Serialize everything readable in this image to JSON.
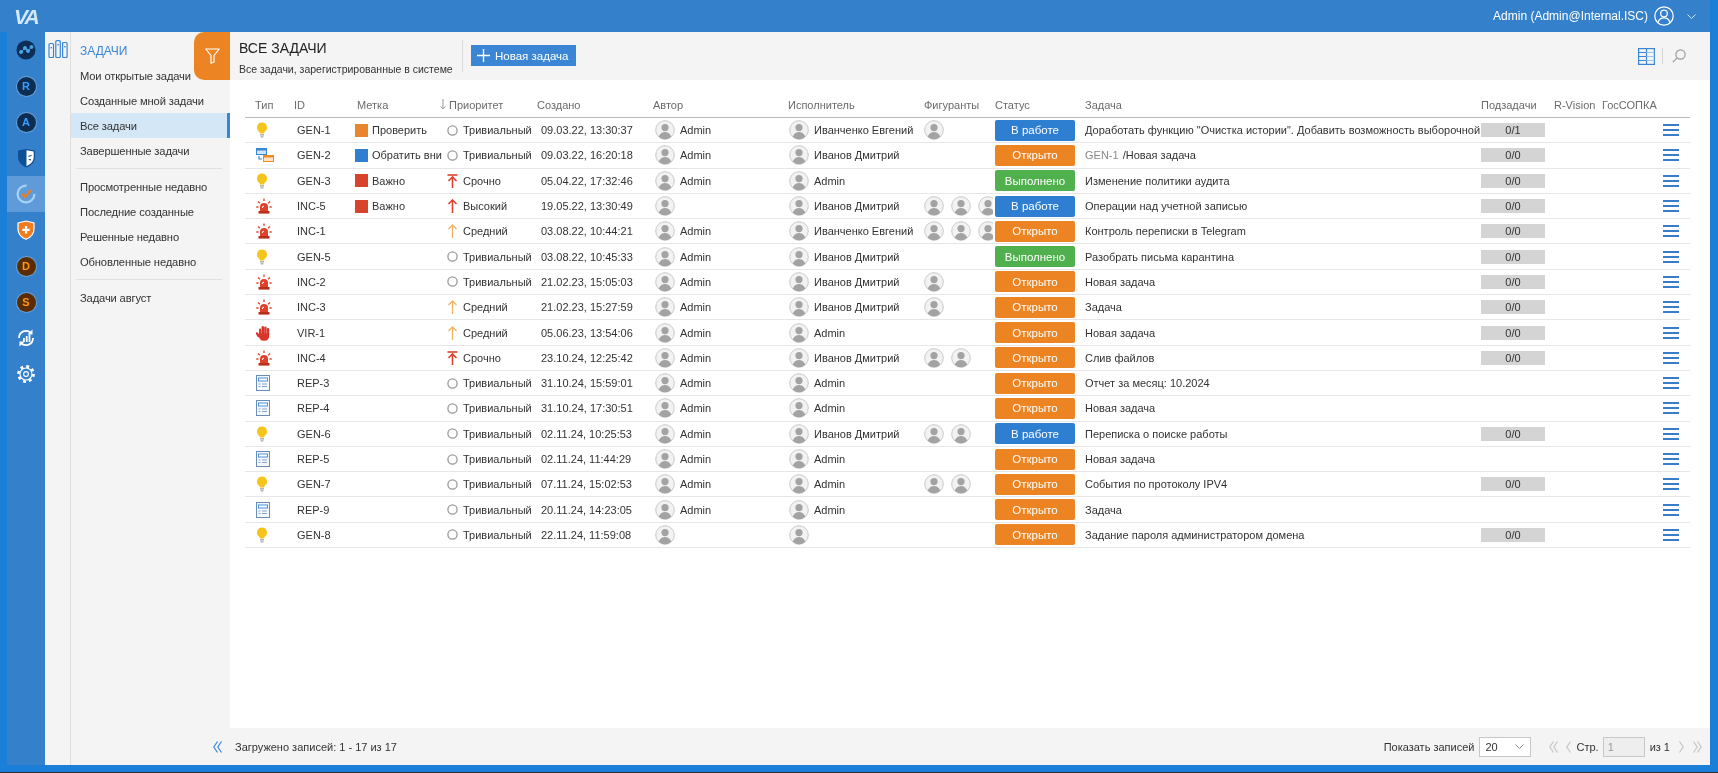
{
  "topbar": {
    "logo": "VA",
    "user": "Admin (Admin@Internal.ISC)"
  },
  "rail": [
    {
      "kind": "network",
      "selected": false
    },
    {
      "kind": "letter",
      "label": "R",
      "color": "#0c2e52",
      "selected": false
    },
    {
      "kind": "letter",
      "label": "A",
      "color": "#0c2e52",
      "selected": false
    },
    {
      "kind": "shield-mask",
      "selected": false
    },
    {
      "kind": "check-ring",
      "selected": true
    },
    {
      "kind": "shield-plus",
      "selected": false
    },
    {
      "kind": "letter",
      "label": "D",
      "color": "#5a2c00",
      "selected": false
    },
    {
      "kind": "letter",
      "label": "S",
      "color": "#5a2c00",
      "selected": false
    },
    {
      "kind": "sync-chart",
      "selected": false
    },
    {
      "kind": "gear",
      "selected": false
    }
  ],
  "nav": {
    "title": "ЗАДАЧИ",
    "groups": [
      {
        "items": [
          {
            "label": "Мои открытые задачи",
            "selected": false
          },
          {
            "label": "Созданные мной задачи",
            "selected": false
          },
          {
            "label": "Все задачи",
            "selected": true
          },
          {
            "label": "Завершенные задачи",
            "selected": false
          }
        ]
      },
      {
        "items": [
          {
            "label": "Просмотренные недавно",
            "selected": false
          },
          {
            "label": "Последние созданные",
            "selected": false
          },
          {
            "label": "Решенные недавно",
            "selected": false
          },
          {
            "label": "Обновленные недавно",
            "selected": false
          }
        ]
      },
      {
        "items": [
          {
            "label": "Задачи август",
            "selected": false
          }
        ]
      }
    ]
  },
  "page": {
    "title": "ВСЕ ЗАДАЧИ",
    "subtitle": "Все задачи, зарегистрированные в системе",
    "new_button": "Новая задача"
  },
  "table": {
    "columns": [
      {
        "label": "Тип",
        "sorted": false
      },
      {
        "label": "ID",
        "sorted": false
      },
      {
        "label": "Метка",
        "sorted": false
      },
      {
        "label": "Приоритет",
        "sorted": true
      },
      {
        "label": "Создано",
        "sorted": false
      },
      {
        "label": "Автор",
        "sorted": false
      },
      {
        "label": "Исполнитель",
        "sorted": false
      },
      {
        "label": "Фигуранты",
        "sorted": false
      },
      {
        "label": "Статус",
        "sorted": false
      },
      {
        "label": "Задача",
        "sorted": false
      },
      {
        "label": "Подзадачи",
        "sorted": false
      },
      {
        "label": "R-Vision",
        "sorted": false
      },
      {
        "label": "ГосСОПКА",
        "sorted": false
      }
    ],
    "rows": [
      {
        "type": {
          "kind": "bulb"
        },
        "id": "GEN-1",
        "tag": {
          "label": "Проверить",
          "color": "#e8852d"
        },
        "priority": {
          "label": "Тривиальный",
          "kind": "trivial"
        },
        "created": "09.03.22, 13:30:37",
        "author": "Admin",
        "assignee": "Иванченко Евгений",
        "figurants": [
          {
            "kind": "avatar"
          }
        ],
        "status": {
          "label": "В работе",
          "color": "#2e7fd2"
        },
        "task": "Доработать функцию \"Очистка истории\". Добавить возможность выборочной",
        "subtasks": "0/1"
      },
      {
        "type": {
          "kind": "windows"
        },
        "id": "GEN-2",
        "tag": {
          "label": "Обратить вни",
          "color": "#2f7ed2"
        },
        "priority": {
          "label": "Тривиальный",
          "kind": "trivial"
        },
        "created": "09.03.22, 16:20:18",
        "author": "Admin",
        "assignee": "Иванов Дмитрий",
        "status": {
          "label": "Открыто",
          "color": "#ed8423"
        },
        "task_parent": "GEN-1",
        "task": "/Новая задача",
        "subtasks": "0/0"
      },
      {
        "type": {
          "kind": "bulb"
        },
        "id": "GEN-3",
        "tag": {
          "label": "Важно",
          "color": "#d8432c"
        },
        "priority": {
          "label": "Срочно",
          "kind": "urgent"
        },
        "created": "05.04.22, 17:32:46",
        "author": "Admin",
        "assignee": "Admin",
        "status": {
          "label": "Выполнено",
          "color": "#50b04d"
        },
        "task": "Изменение политики аудита",
        "subtasks": "0/0"
      },
      {
        "type": {
          "kind": "siren"
        },
        "id": "INC-5",
        "tag": {
          "label": "Важно",
          "color": "#d8432c"
        },
        "priority": {
          "label": "Высокий",
          "kind": "high"
        },
        "created": "19.05.22, 13:30:49",
        "assignee": "Иванов Дмитрий",
        "figurants": [
          {
            "kind": "avatar"
          },
          {
            "kind": "avatar"
          },
          {
            "kind": "avatar"
          }
        ],
        "status": {
          "label": "В работе",
          "color": "#2e7fd2"
        },
        "task": "Операции над учетной записью",
        "subtasks": "0/0"
      },
      {
        "type": {
          "kind": "siren"
        },
        "id": "INC-1",
        "priority": {
          "label": "Средний",
          "kind": "medium"
        },
        "created": "03.08.22, 10:44:21",
        "author": "Admin",
        "assignee": "Иванченко Евгений",
        "figurants": [
          {
            "kind": "avatar"
          },
          {
            "kind": "avatar"
          },
          {
            "kind": "avatar"
          }
        ],
        "status": {
          "label": "Открыто",
          "color": "#ed8423"
        },
        "task": "Контроль переписки в Telegram",
        "subtasks": "0/0"
      },
      {
        "type": {
          "kind": "bulb"
        },
        "id": "GEN-5",
        "priority": {
          "label": "Тривиальный",
          "kind": "trivial"
        },
        "created": "03.08.22, 10:45:33",
        "author": "Admin",
        "assignee": "Иванов Дмитрий",
        "status": {
          "label": "Выполнено",
          "color": "#50b04d"
        },
        "task": "Разобрать письма карантина",
        "subtasks": "0/0"
      },
      {
        "type": {
          "kind": "siren"
        },
        "id": "INC-2",
        "priority": {
          "label": "Тривиальный",
          "kind": "trivial"
        },
        "created": "21.02.23, 15:05:03",
        "author": "Admin",
        "assignee": "Иванов Дмитрий",
        "figurants": [
          {
            "kind": "avatar"
          }
        ],
        "status": {
          "label": "Открыто",
          "color": "#ed8423"
        },
        "task": "Новая задача",
        "subtasks": "0/0"
      },
      {
        "type": {
          "kind": "siren"
        },
        "id": "INC-3",
        "priority": {
          "label": "Средний",
          "kind": "medium"
        },
        "created": "21.02.23, 15:27:59",
        "author": "Admin",
        "assignee": "Иванов Дмитрий",
        "figurants": [
          {
            "kind": "avatar"
          }
        ],
        "status": {
          "label": "Открыто",
          "color": "#ed8423"
        },
        "task": "Задача",
        "subtasks": "0/0"
      },
      {
        "type": {
          "kind": "hand"
        },
        "id": "VIR-1",
        "priority": {
          "label": "Средний",
          "kind": "medium"
        },
        "created": "05.06.23, 13:54:06",
        "author": "Admin",
        "assignee": "Admin",
        "status": {
          "label": "Открыто",
          "color": "#ed8423"
        },
        "task": "Новая задача",
        "subtasks": "0/0"
      },
      {
        "type": {
          "kind": "siren"
        },
        "id": "INC-4",
        "priority": {
          "label": "Срочно",
          "kind": "urgent"
        },
        "created": "23.10.24, 12:25:42",
        "author": "Admin",
        "assignee": "Иванов Дмитрий",
        "figurants": [
          {
            "kind": "avatar"
          },
          {
            "kind": "avatar"
          }
        ],
        "status": {
          "label": "Открыто",
          "color": "#ed8423"
        },
        "task": "Слив файлов",
        "subtasks": "0/0"
      },
      {
        "type": {
          "kind": "document"
        },
        "id": "REP-3",
        "priority": {
          "label": "Тривиальный",
          "kind": "trivial"
        },
        "created": "31.10.24, 15:59:01",
        "author": "Admin",
        "assignee": "Admin",
        "status": {
          "label": "Открыто",
          "color": "#ed8423"
        },
        "task": "Отчет за месяц: 10.2024"
      },
      {
        "type": {
          "kind": "document"
        },
        "id": "REP-4",
        "priority": {
          "label": "Тривиальный",
          "kind": "trivial"
        },
        "created": "31.10.24, 17:30:51",
        "author": "Admin",
        "assignee": "Admin",
        "status": {
          "label": "Открыто",
          "color": "#ed8423"
        },
        "task": "Новая задача"
      },
      {
        "type": {
          "kind": "bulb"
        },
        "id": "GEN-6",
        "priority": {
          "label": "Тривиальный",
          "kind": "trivial"
        },
        "created": "02.11.24, 10:25:53",
        "author": "Admin",
        "assignee": "Иванов Дмитрий",
        "figurants": [
          {
            "kind": "avatar"
          },
          {
            "kind": "avatar"
          }
        ],
        "status": {
          "label": "В работе",
          "color": "#2e7fd2"
        },
        "task": "Переписка о поиске работы",
        "subtasks": "0/0"
      },
      {
        "type": {
          "kind": "document"
        },
        "id": "REP-5",
        "priority": {
          "label": "Тривиальный",
          "kind": "trivial"
        },
        "created": "02.11.24, 11:44:29",
        "author": "Admin",
        "assignee": "Admin",
        "status": {
          "label": "Открыто",
          "color": "#ed8423"
        },
        "task": "Новая задача"
      },
      {
        "type": {
          "kind": "bulb"
        },
        "id": "GEN-7",
        "priority": {
          "label": "Тривиальный",
          "kind": "trivial"
        },
        "created": "07.11.24, 15:02:53",
        "author": "Admin",
        "assignee": "Admin",
        "figurants": [
          {
            "kind": "avatar"
          },
          {
            "kind": "avatar"
          }
        ],
        "status": {
          "label": "Открыто",
          "color": "#ed8423"
        },
        "task": "События по протоколу IPV4",
        "subtasks": "0/0"
      },
      {
        "type": {
          "kind": "document"
        },
        "id": "REP-9",
        "priority": {
          "label": "Тривиальный",
          "kind": "trivial"
        },
        "created": "20.11.24, 14:23:05",
        "author": "Admin",
        "assignee": "Admin",
        "status": {
          "label": "Открыто",
          "color": "#ed8423"
        },
        "task": "Задача"
      },
      {
        "type": {
          "kind": "bulb"
        },
        "id": "GEN-8",
        "priority": {
          "label": "Тривиальный",
          "kind": "trivial"
        },
        "created": "22.11.24, 11:59:08",
        "status": {
          "label": "Открыто",
          "color": "#ed8423"
        },
        "task": "Задание пароля администратором домена",
        "subtasks": "0/0"
      }
    ]
  },
  "footer": {
    "loaded": "Загружено записей: 1 - 17 из 17",
    "page_size_label": "Показать записей",
    "page_size": "20",
    "pager": {
      "page_label": "Стр.",
      "page": "1",
      "total": "из 1",
      "disabled": true
    }
  }
}
